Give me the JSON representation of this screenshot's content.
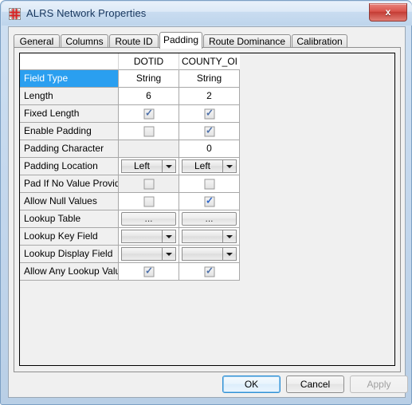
{
  "window": {
    "title": "ALRS Network Properties",
    "icon": "grid-table-icon",
    "close_label": "x",
    "accent_title_color": "#17365d",
    "selection_color": "#2a9ff0"
  },
  "tabs": [
    {
      "label": "General",
      "selected": false
    },
    {
      "label": "Columns",
      "selected": false
    },
    {
      "label": "Route ID",
      "selected": false
    },
    {
      "label": "Padding",
      "selected": true
    },
    {
      "label": "Route Dominance",
      "selected": false
    },
    {
      "label": "Calibration",
      "selected": false
    }
  ],
  "grid": {
    "corner_header": "",
    "columns": [
      "DOTID",
      "COUNTY_OI"
    ],
    "rows": [
      {
        "label": "Field Type",
        "selected": true,
        "type": "text",
        "values": [
          "String",
          "String"
        ]
      },
      {
        "label": "Length",
        "selected": false,
        "type": "text",
        "values": [
          "6",
          "2"
        ]
      },
      {
        "label": "Fixed Length",
        "selected": false,
        "type": "checkbox",
        "values": [
          true,
          true
        ],
        "disabled": [
          false,
          false
        ]
      },
      {
        "label": "Enable Padding",
        "selected": false,
        "type": "checkbox",
        "values": [
          false,
          true
        ],
        "disabled": [
          false,
          false
        ]
      },
      {
        "label": "Padding Character",
        "selected": false,
        "type": "text",
        "values": [
          "",
          "0"
        ],
        "disabled": [
          true,
          false
        ]
      },
      {
        "label": "Padding Location",
        "selected": false,
        "type": "combo",
        "values": [
          "Left",
          "Left"
        ]
      },
      {
        "label": "Pad If No Value Provided",
        "selected": false,
        "type": "checkbox",
        "values": [
          false,
          false
        ],
        "disabled": [
          true,
          false
        ]
      },
      {
        "label": "Allow Null Values",
        "selected": false,
        "type": "checkbox",
        "values": [
          false,
          true
        ],
        "disabled": [
          false,
          false
        ],
        "bright": [
          false,
          true
        ]
      },
      {
        "label": "Lookup Table",
        "selected": false,
        "type": "button",
        "values": [
          "...",
          "..."
        ]
      },
      {
        "label": "Lookup Key Field",
        "selected": false,
        "type": "combo",
        "values": [
          "",
          ""
        ]
      },
      {
        "label": "Lookup Display Field",
        "selected": false,
        "type": "combo",
        "values": [
          "",
          ""
        ]
      },
      {
        "label": "Allow Any Lookup Value",
        "selected": false,
        "type": "checkbox",
        "values": [
          true,
          true
        ],
        "disabled": [
          false,
          false
        ]
      }
    ]
  },
  "buttons": {
    "ok": "OK",
    "cancel": "Cancel",
    "apply": "Apply"
  }
}
